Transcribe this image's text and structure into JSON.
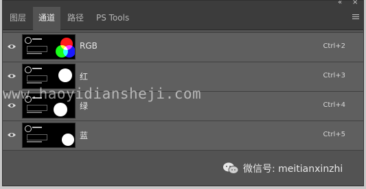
{
  "panel": {
    "collapse_glyph": "«",
    "close_glyph": "×",
    "tabs": [
      {
        "label": "图层"
      },
      {
        "label": "通道"
      },
      {
        "label": "路径"
      },
      {
        "label": "PS Tools"
      }
    ],
    "active_tab": 1
  },
  "channels": [
    {
      "name": "RGB",
      "shortcut": "Ctrl+2",
      "visible": true,
      "selected": true
    },
    {
      "name": "红",
      "shortcut": "Ctrl+3",
      "visible": true,
      "selected": true
    },
    {
      "name": "绿",
      "shortcut": "Ctrl+4",
      "visible": true,
      "selected": true
    },
    {
      "name": "蓝",
      "shortcut": "Ctrl+5",
      "visible": true,
      "selected": true
    }
  ],
  "overlays": {
    "watermark_text": "www.haoyidiansheji.com",
    "wechat_text": "微信号: meitianxinzhi"
  },
  "icons": {
    "eye": "eye-icon",
    "menu": "panel-menu-icon",
    "wechat": "wechat-icon"
  },
  "colors": {
    "panel_bg": "#535353",
    "tab_bar_bg": "#3c3c3c",
    "selected_row_bg": "#5f5f5f"
  }
}
